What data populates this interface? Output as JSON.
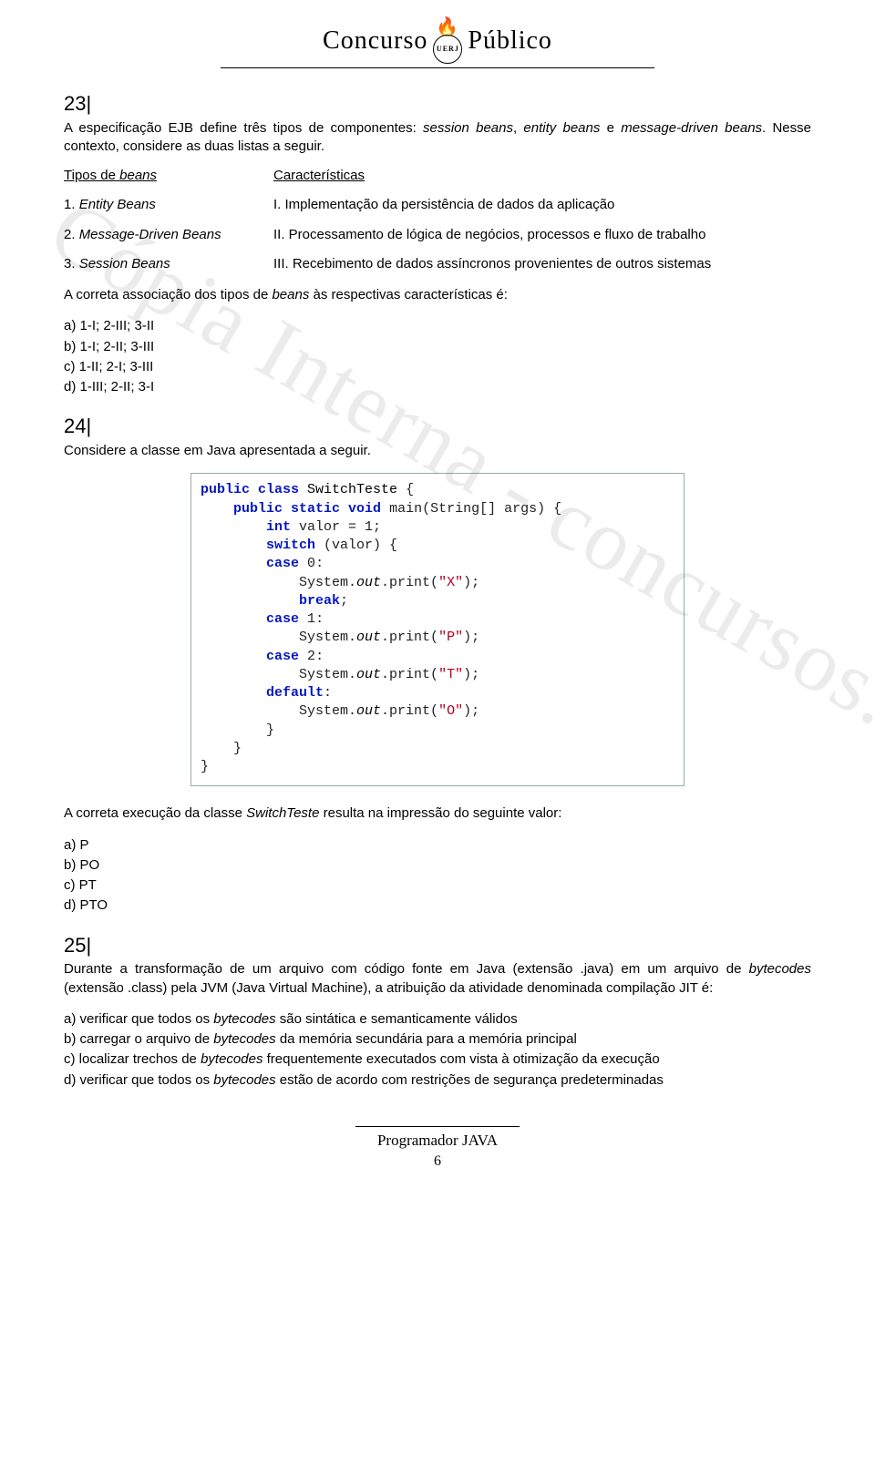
{
  "header": {
    "left": "Concurso",
    "right": "Público",
    "crest_label": "UERJ"
  },
  "watermark": "Cópia Interna - concursos.srh.uerj.br/",
  "q23": {
    "num": "23|",
    "intro_a": "A especificação EJB define três tipos de componentes: ",
    "intro_i1": "session beans",
    "intro_b": ", ",
    "intro_i2": "entity beans",
    "intro_c": " e ",
    "intro_i3": "message-driven beans",
    "intro_d": ". Nesse contexto, considere as duas listas a seguir.",
    "col_left_head_a": "Tipos de ",
    "col_left_head_i": "beans",
    "col_right_head": "Características",
    "rows": [
      {
        "l_a": "1. ",
        "l_i": "Entity Beans",
        "r": "I. Implementação da persistência de dados da aplicação"
      },
      {
        "l_a": "2. ",
        "l_i": "Message-Driven Beans",
        "r": "II. Processamento de lógica de negócios, processos e fluxo de trabalho"
      },
      {
        "l_a": "3. ",
        "l_i": "Session Beans",
        "r": "III. Recebimento de dados assíncronos provenientes de outros sistemas"
      }
    ],
    "assoc_a": "A correta associação dos tipos de ",
    "assoc_i": "beans",
    "assoc_b": " às respectivas características é:",
    "opts": [
      "a) 1-I; 2-III; 3-II",
      "b) 1-I; 2-II; 3-III",
      "c) 1-II; 2-I; 3-III",
      "d) 1-III; 2-II; 3-I"
    ]
  },
  "q24": {
    "num": "24|",
    "intro": "Considere a classe em Java apresentada a seguir.",
    "result_a": "A correta execução da classe ",
    "result_i": "SwitchTeste",
    "result_b": " resulta na impressão do seguinte valor:",
    "opts": [
      "a) P",
      "b) PO",
      "c) PT",
      "d) PTO"
    ],
    "code": {
      "class_name": "SwitchTeste",
      "main_sig_a": "main(String[] args) {",
      "var_decl_a": "valor = 1;",
      "switch_a": "(valor) {",
      "cases": [
        {
          "label": "0",
          "out": "\"X\"",
          "break": true
        },
        {
          "label": "1",
          "out": "\"P\"",
          "break": false
        },
        {
          "label": "2",
          "out": "\"T\"",
          "break": false
        }
      ],
      "default_out": "\"O\""
    }
  },
  "q25": {
    "num": "25|",
    "intro_a": "Durante a transformação de um arquivo com código fonte em Java (extensão .java) em um arquivo de ",
    "intro_i1": "bytecodes",
    "intro_b": " (extensão .class) pela JVM (Java Virtual Machine), a atribuição da atividade denominada compilação JIT é:",
    "opts_pre": [
      "a) verificar que todos os ",
      "b) carregar o arquivo de ",
      "c) localizar trechos de ",
      "d) verificar que todos os "
    ],
    "opts_i": [
      "bytecodes",
      "bytecodes",
      "bytecodes",
      "bytecodes"
    ],
    "opts_post": [
      " são sintática e semanticamente válidos",
      " da memória secundária para a memória principal",
      " frequentemente executados com vista à otimização da execução",
      " estão de acordo com restrições de segurança predeterminadas"
    ]
  },
  "footer": {
    "title": "Programador JAVA",
    "page": "6"
  }
}
